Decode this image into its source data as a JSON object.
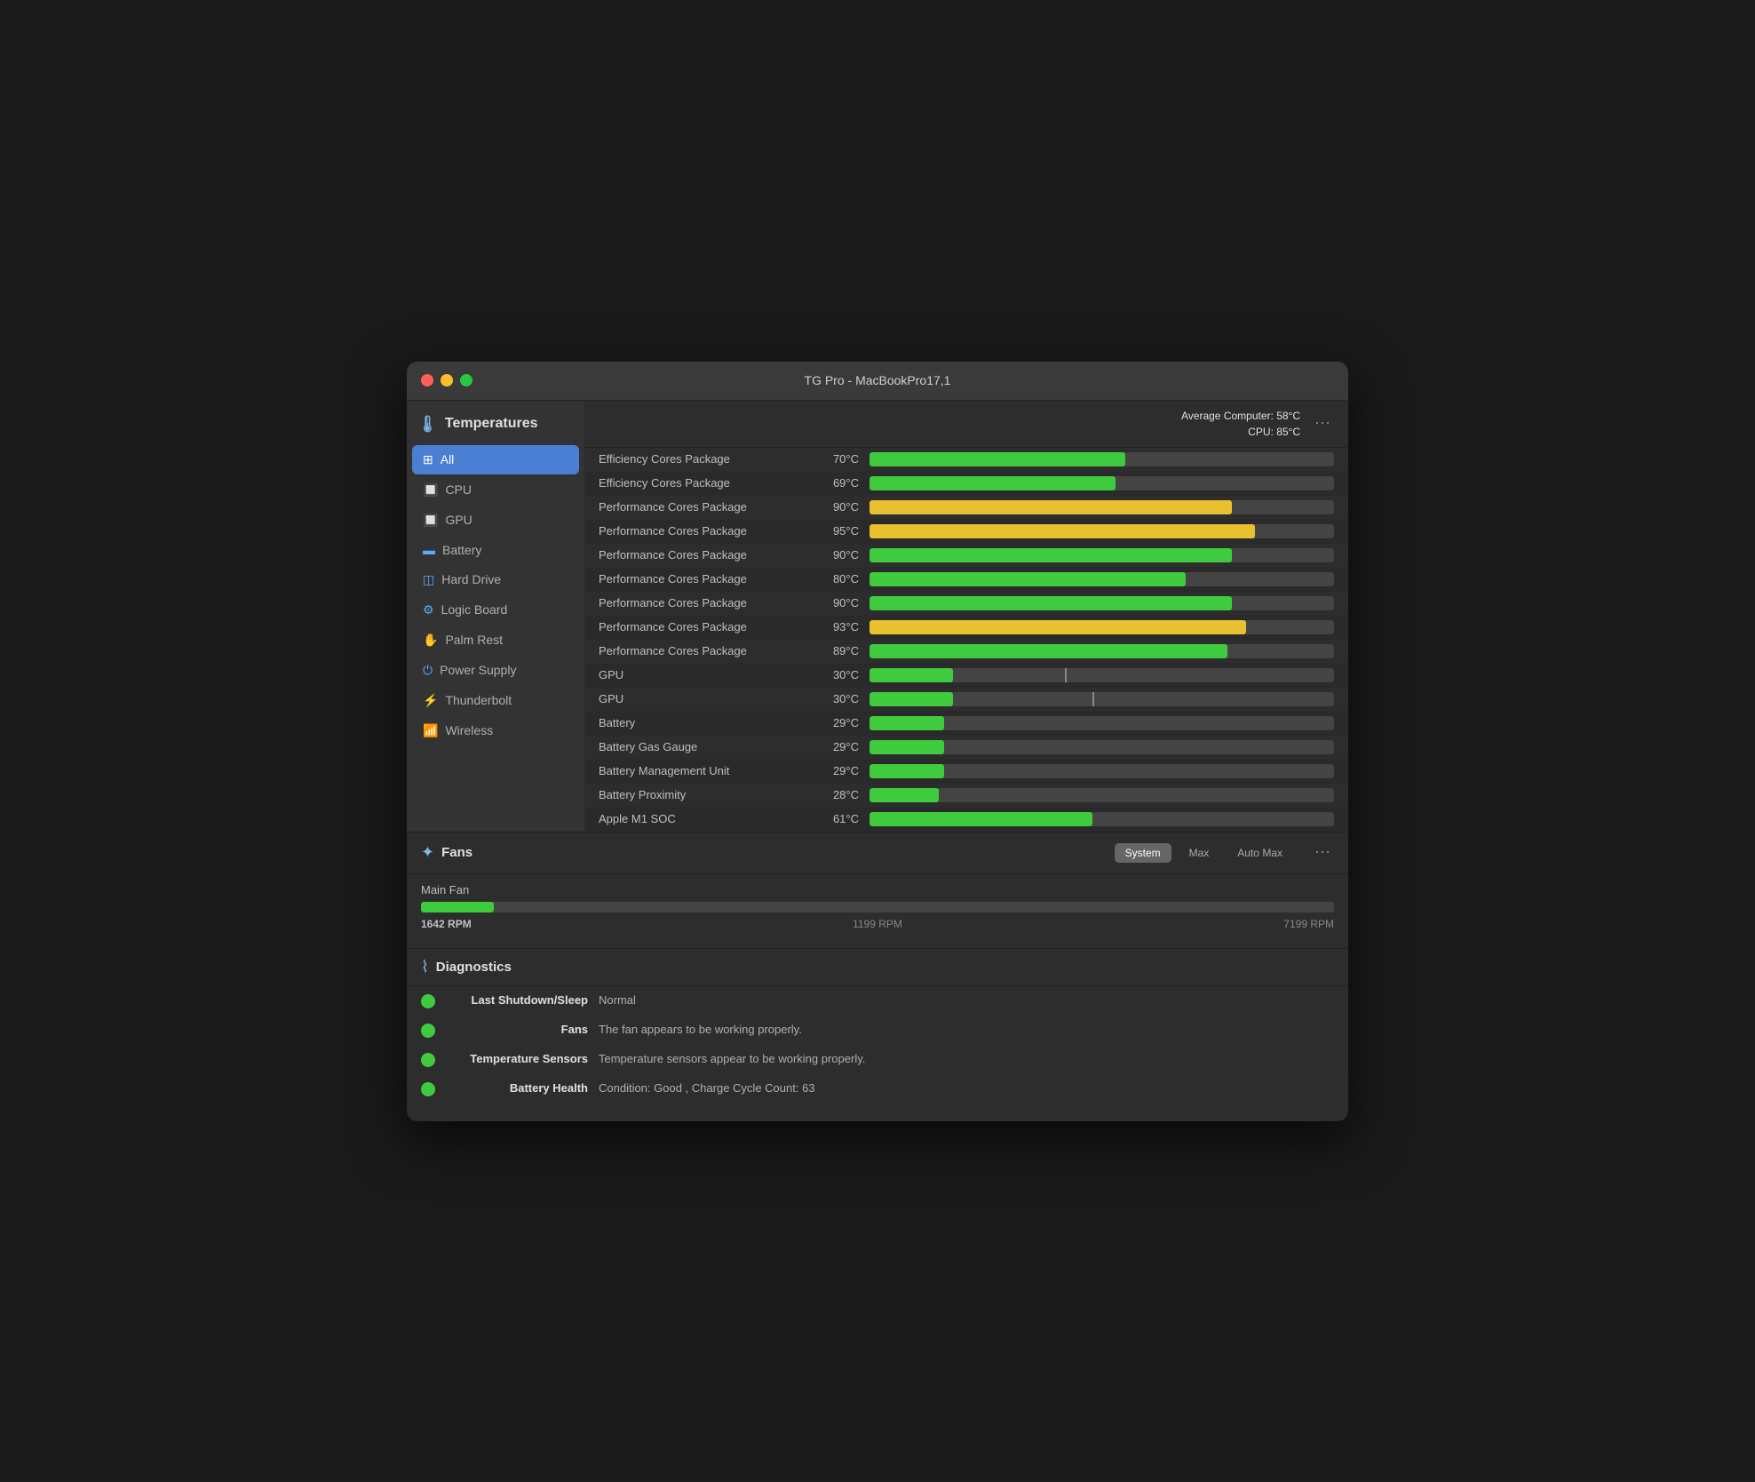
{
  "window": {
    "title": "TG Pro - MacBookPro17,1"
  },
  "header": {
    "average_label": "Average Computer:",
    "average_value": "58°C",
    "cpu_label": "CPU:",
    "cpu_value": "85°C"
  },
  "sidebar": {
    "section_label": "Temperatures",
    "items": [
      {
        "id": "all",
        "label": "All",
        "icon": "⊞",
        "active": true
      },
      {
        "id": "cpu",
        "label": "CPU",
        "icon": "🔲",
        "active": false
      },
      {
        "id": "gpu",
        "label": "GPU",
        "icon": "🔲",
        "active": false
      },
      {
        "id": "battery",
        "label": "Battery",
        "icon": "🔋",
        "active": false
      },
      {
        "id": "harddrive",
        "label": "Hard Drive",
        "icon": "💾",
        "active": false
      },
      {
        "id": "logicboard",
        "label": "Logic Board",
        "icon": "⚙",
        "active": false
      },
      {
        "id": "palmrest",
        "label": "Palm Rest",
        "icon": "✋",
        "active": false
      },
      {
        "id": "powersupply",
        "label": "Power Supply",
        "icon": "⏻",
        "active": false
      },
      {
        "id": "thunderbolt",
        "label": "Thunderbolt",
        "icon": "⚡",
        "active": false
      },
      {
        "id": "wireless",
        "label": "Wireless",
        "icon": "📶",
        "active": false
      }
    ]
  },
  "temperatures": [
    {
      "name": "Efficiency Cores Package",
      "value": "70°C",
      "percent": 55,
      "color": "green"
    },
    {
      "name": "Efficiency Cores Package",
      "value": "69°C",
      "percent": 53,
      "color": "green"
    },
    {
      "name": "Performance Cores Package",
      "value": "90°C",
      "percent": 78,
      "color": "yellow"
    },
    {
      "name": "Performance Cores Package",
      "value": "95°C",
      "percent": 83,
      "color": "yellow"
    },
    {
      "name": "Performance Cores Package",
      "value": "90°C",
      "percent": 78,
      "color": "green"
    },
    {
      "name": "Performance Cores Package",
      "value": "80°C",
      "percent": 68,
      "color": "green"
    },
    {
      "name": "Performance Cores Package",
      "value": "90°C",
      "percent": 78,
      "color": "green"
    },
    {
      "name": "Performance Cores Package",
      "value": "93°C",
      "percent": 81,
      "color": "yellow"
    },
    {
      "name": "Performance Cores Package",
      "value": "89°C",
      "percent": 77,
      "color": "green"
    },
    {
      "name": "GPU",
      "value": "30°C",
      "percent": 18,
      "color": "green",
      "tick": 42
    },
    {
      "name": "GPU",
      "value": "30°C",
      "percent": 18,
      "color": "green",
      "tick": 48
    },
    {
      "name": "Battery",
      "value": "29°C",
      "percent": 16,
      "color": "green"
    },
    {
      "name": "Battery Gas Gauge",
      "value": "29°C",
      "percent": 16,
      "color": "green"
    },
    {
      "name": "Battery Management Unit",
      "value": "29°C",
      "percent": 16,
      "color": "green"
    },
    {
      "name": "Battery Proximity",
      "value": "28°C",
      "percent": 15,
      "color": "green"
    },
    {
      "name": "Apple M1 SOC",
      "value": "61°C",
      "percent": 48,
      "color": "green"
    }
  ],
  "fans": {
    "section_label": "Fans",
    "controls": [
      "System",
      "Max",
      "Auto Max"
    ],
    "active_control": "System",
    "main_fan": {
      "label": "Main Fan",
      "current_rpm": "1642 RPM",
      "min_rpm": "1199 RPM",
      "max_rpm": "7199 RPM",
      "percent": 8
    }
  },
  "diagnostics": {
    "section_label": "Diagnostics",
    "items": [
      {
        "label": "Last Shutdown/Sleep",
        "value": "Normal"
      },
      {
        "label": "Fans",
        "value": "The fan appears to be working properly."
      },
      {
        "label": "Temperature Sensors",
        "value": "Temperature sensors appear to be working properly."
      },
      {
        "label": "Battery Health",
        "value": "Condition: Good , Charge Cycle Count: 63"
      }
    ]
  }
}
